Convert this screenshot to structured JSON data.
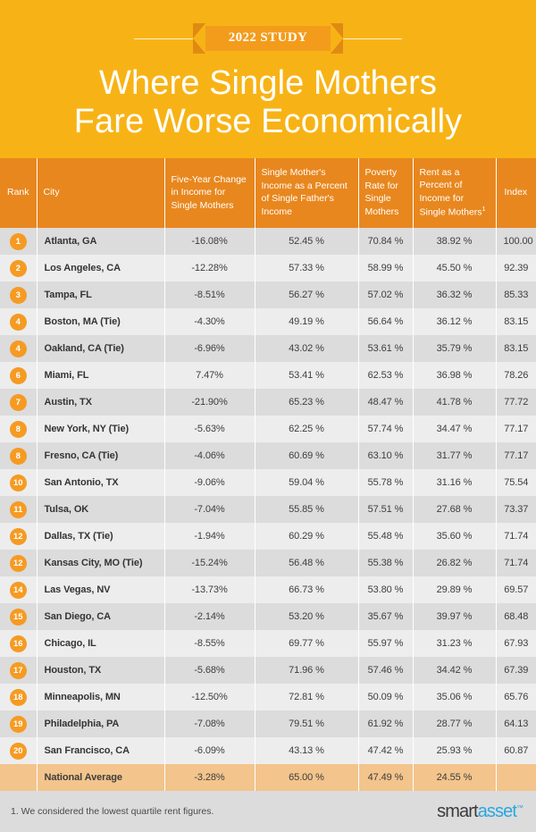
{
  "hero": {
    "ribbon_label": "2022 STUDY",
    "title_line1": "Where Single Mothers",
    "title_line2": "Fare Worse Economically"
  },
  "colors": {
    "hero_background": "#f7b316",
    "ribbon_center": "#f39c1c",
    "ribbon_tail": "#e08a14",
    "table_header": "#e8871e",
    "badge": "#f59b23",
    "row_odd": "#dcdcdc",
    "row_even": "#ededed",
    "row_average": "#f3c48c",
    "logo_smart": "#3b3b3b",
    "logo_asset": "#29a8e0"
  },
  "table": {
    "columns": [
      "Rank",
      "City",
      "Five-Year Change in Income for Single Mothers",
      "Single Mother's Income as a Percent of Single Father's Income",
      "Poverty Rate for Single Mothers",
      "Rent as a Percent of Income for Single Mothers",
      "Index"
    ],
    "column_footnote_marker": "1",
    "rows": [
      {
        "rank": "1",
        "city": "Atlanta, GA",
        "change": "-16.08%",
        "pct_father": "52.45 %",
        "poverty": "70.84 %",
        "rent": "38.92 %",
        "index": "100.00"
      },
      {
        "rank": "2",
        "city": "Los Angeles, CA",
        "change": "-12.28%",
        "pct_father": "57.33 %",
        "poverty": "58.99 %",
        "rent": "45.50 %",
        "index": "92.39"
      },
      {
        "rank": "3",
        "city": "Tampa, FL",
        "change": "-8.51%",
        "pct_father": "56.27 %",
        "poverty": "57.02 %",
        "rent": "36.32 %",
        "index": "85.33"
      },
      {
        "rank": "4",
        "city": "Boston, MA (Tie)",
        "change": "-4.30%",
        "pct_father": "49.19 %",
        "poverty": "56.64 %",
        "rent": "36.12 %",
        "index": "83.15"
      },
      {
        "rank": "4",
        "city": "Oakland, CA (Tie)",
        "change": "-6.96%",
        "pct_father": "43.02 %",
        "poverty": "53.61 %",
        "rent": "35.79 %",
        "index": "83.15"
      },
      {
        "rank": "6",
        "city": "Miami, FL",
        "change": "7.47%",
        "pct_father": "53.41 %",
        "poverty": "62.53 %",
        "rent": "36.98 %",
        "index": "78.26"
      },
      {
        "rank": "7",
        "city": "Austin, TX",
        "change": "-21.90%",
        "pct_father": "65.23 %",
        "poverty": "48.47 %",
        "rent": "41.78 %",
        "index": "77.72"
      },
      {
        "rank": "8",
        "city": "New York, NY (Tie)",
        "change": "-5.63%",
        "pct_father": "62.25 %",
        "poverty": "57.74 %",
        "rent": "34.47 %",
        "index": "77.17"
      },
      {
        "rank": "8",
        "city": "Fresno, CA (Tie)",
        "change": "-4.06%",
        "pct_father": "60.69 %",
        "poverty": "63.10 %",
        "rent": "31.77 %",
        "index": "77.17"
      },
      {
        "rank": "10",
        "city": "San Antonio, TX",
        "change": "-9.06%",
        "pct_father": "59.04 %",
        "poverty": "55.78 %",
        "rent": "31.16 %",
        "index": "75.54"
      },
      {
        "rank": "11",
        "city": "Tulsa, OK",
        "change": "-7.04%",
        "pct_father": "55.85 %",
        "poverty": "57.51 %",
        "rent": "27.68 %",
        "index": "73.37"
      },
      {
        "rank": "12",
        "city": "Dallas, TX (Tie)",
        "change": "-1.94%",
        "pct_father": "60.29 %",
        "poverty": "55.48 %",
        "rent": "35.60 %",
        "index": "71.74"
      },
      {
        "rank": "12",
        "city": "Kansas City, MO (Tie)",
        "change": "-15.24%",
        "pct_father": "56.48 %",
        "poverty": "55.38 %",
        "rent": "26.82 %",
        "index": "71.74"
      },
      {
        "rank": "14",
        "city": "Las Vegas, NV",
        "change": "-13.73%",
        "pct_father": "66.73 %",
        "poverty": "53.80 %",
        "rent": "29.89 %",
        "index": "69.57"
      },
      {
        "rank": "15",
        "city": "San Diego, CA",
        "change": "-2.14%",
        "pct_father": "53.20 %",
        "poverty": "35.67 %",
        "rent": "39.97 %",
        "index": "68.48"
      },
      {
        "rank": "16",
        "city": "Chicago, IL",
        "change": "-8.55%",
        "pct_father": "69.77 %",
        "poverty": "55.97 %",
        "rent": "31.23 %",
        "index": "67.93"
      },
      {
        "rank": "17",
        "city": "Houston, TX",
        "change": "-5.68%",
        "pct_father": "71.96 %",
        "poverty": "57.46 %",
        "rent": "34.42 %",
        "index": "67.39"
      },
      {
        "rank": "18",
        "city": "Minneapolis, MN",
        "change": "-12.50%",
        "pct_father": "72.81 %",
        "poverty": "50.09 %",
        "rent": "35.06 %",
        "index": "65.76"
      },
      {
        "rank": "19",
        "city": "Philadelphia, PA",
        "change": "-7.08%",
        "pct_father": "79.51 %",
        "poverty": "61.92 %",
        "rent": "28.77 %",
        "index": "64.13"
      },
      {
        "rank": "20",
        "city": "San Francisco, CA",
        "change": "-6.09%",
        "pct_father": "43.13 %",
        "poverty": "47.42 %",
        "rent": "25.93 %",
        "index": "60.87"
      }
    ],
    "average_row": {
      "rank": "",
      "city": "National Average",
      "change": "-3.28%",
      "pct_father": "65.00 %",
      "poverty": "47.49 %",
      "rent": "24.55 %",
      "index": ""
    }
  },
  "footer": {
    "footnote": "1. We considered the lowest quartile rent figures.",
    "logo_smart": "smart",
    "logo_asset": "asset",
    "logo_tm": "™"
  }
}
